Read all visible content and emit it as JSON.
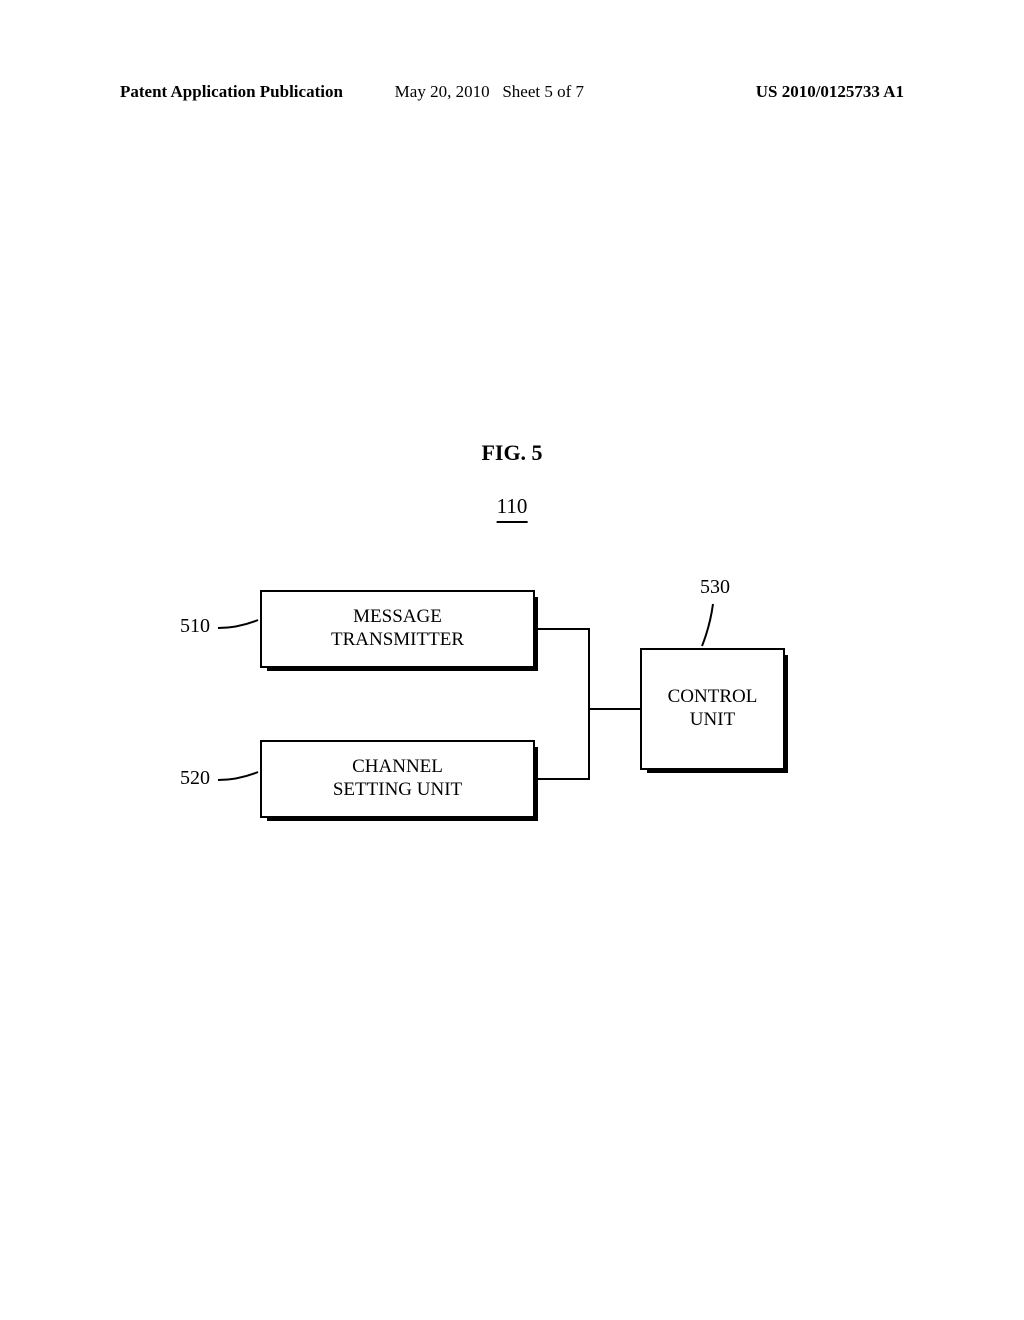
{
  "header": {
    "left": "Patent Application Publication",
    "center_date": "May 20, 2010",
    "center_sheet": "Sheet 5 of 7",
    "right": "US 2010/0125733 A1"
  },
  "figure": {
    "label": "FIG.  5",
    "number": "110"
  },
  "blocks": {
    "message_transmitter": {
      "ref": "510",
      "line1": "MESSAGE",
      "line2": "TRANSMITTER"
    },
    "channel_setting_unit": {
      "ref": "520",
      "line1": "CHANNEL",
      "line2": "SETTING UNIT"
    },
    "control_unit": {
      "ref": "530",
      "line1": "CONTROL",
      "line2": "UNIT"
    }
  }
}
